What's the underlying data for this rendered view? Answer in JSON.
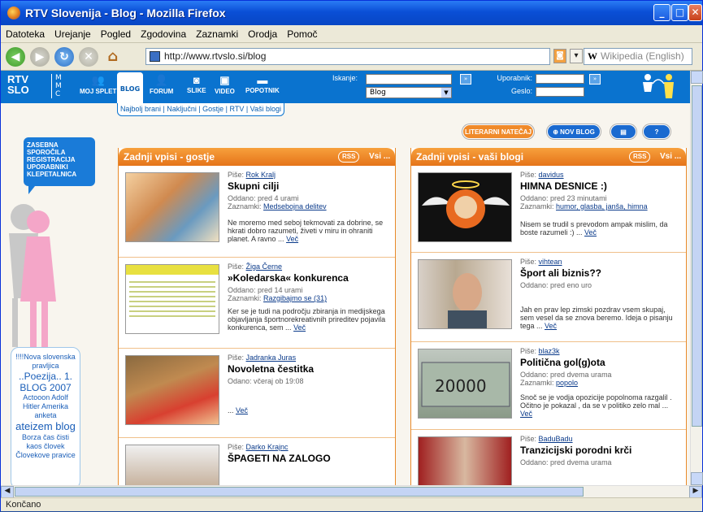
{
  "window": {
    "title": "RTV Slovenija - Blog - Mozilla Firefox"
  },
  "menu": [
    "Datoteka",
    "Urejanje",
    "Pogled",
    "Zgodovina",
    "Zaznamki",
    "Orodja",
    "Pomoč"
  ],
  "nav": {
    "url": "http://www.rtvslo.si/blog",
    "search_engine": "W",
    "search_placeholder": "Wikipedia (English)"
  },
  "status": "Končano",
  "site": {
    "logo_line1": "RTV",
    "logo_line2": "SLO",
    "mmc": "M M C",
    "topnav": [
      {
        "label": "MOJ SPLET",
        "icon": "people-icon"
      },
      {
        "label": "BLOG",
        "icon": ""
      },
      {
        "label": "FORUM",
        "icon": "forum-icon"
      },
      {
        "label": "SLIKE",
        "icon": "camera-icon"
      },
      {
        "label": "VIDEO",
        "icon": "video-icon"
      },
      {
        "label": "POPOTNIK",
        "icon": "suitcase-icon"
      }
    ],
    "subnav": "Najbolj brani | Naključni | Gostje | RTV | Vaši blogi",
    "search_label": "Iskanje:",
    "search_select": "Blog",
    "user_label": "Uporabnik:",
    "password_label": "Geslo:",
    "buttons": {
      "literary": "LITERARNI NATEČAJ",
      "new_blog": "NOV BLOG",
      "help": "?"
    },
    "sidebar_bubble": [
      "ZASEBNA SPOROČILA",
      "REGISTRACIJA",
      "UPORABNIKI",
      "KLEPETALNICA"
    ],
    "tag_cloud": [
      {
        "text": "!!!!Nova slovenska",
        "size": 9
      },
      {
        "text": "pravljica",
        "size": 9
      },
      {
        "text": "..Poezija.. 1.",
        "size": 12
      },
      {
        "text": "BLOG 2007",
        "size": 12
      },
      {
        "text": "Actooon Adolf",
        "size": 9
      },
      {
        "text": "Hitler Amerika",
        "size": 9
      },
      {
        "text": "anketa",
        "size": 9
      },
      {
        "text": "ateizem blog",
        "size": 13
      },
      {
        "text": "Borza čas čisti",
        "size": 9
      },
      {
        "text": "kaos človek",
        "size": 9
      },
      {
        "text": "Človekove pravice",
        "size": 9
      }
    ]
  },
  "panels": [
    {
      "title": "Zadnji vpisi - gostje",
      "rss": "RSS",
      "all": "Vsi ...",
      "entries": [
        {
          "pise": "Piše:",
          "author": "Rok Kralj",
          "title": "Skupni cilji",
          "posted": "Oddano: pred 4 urami",
          "tags_label": "Zaznamki:",
          "tags": "Medsebojna delitev",
          "body": "Ne moremo med seboj tekmovati za dobrine, se hkrati dobro razumeti, živeti v miru in ohraniti planet. A ravno ...",
          "more": "Več",
          "thumb": "hands"
        },
        {
          "pise": "Piše:",
          "author": "Žiga Černe",
          "title": "»Koledarska« konkurenca",
          "posted": "Oddano: pred 14 urami",
          "tags_label": "Zaznamki:",
          "tags": "Razgibajmo se (31)",
          "body": "Ker se je tudi na področju zbiranja in medijskega objavljanja športnorekreativnih prireditev pojavila konkurenca, sem ...",
          "more": "Več",
          "thumb": "webpage"
        },
        {
          "pise": "Piše:",
          "author": "Jadranka Juras",
          "title": "Novoletna čestitka",
          "posted": "Odano: včeraj ob 19:08",
          "tags_label": "",
          "tags": "",
          "body": "...",
          "more": "Več",
          "thumb": "dog"
        },
        {
          "pise": "Piše:",
          "author": "Darko Krajnc",
          "title": "ŠPAGETI NA ZALOGO",
          "posted": "",
          "tags_label": "",
          "tags": "",
          "body": "",
          "more": "",
          "thumb": "man"
        }
      ]
    },
    {
      "title": "Zadnji vpisi - vaši blogi",
      "rss": "RSS",
      "all": "Vsi ...",
      "entries": [
        {
          "pise": "Piše:",
          "author": "davidus",
          "title": "HIMNA DESNICE :)",
          "posted": "Oddano: pred 23 minutami",
          "tags_label": "Zaznamki:",
          "tags": "humor, glasba, janša, himna",
          "body": "Nisem se trudil s prevodom ampak mislim, da boste razumeli :) ...",
          "more": "Več",
          "thumb": "cartoon"
        },
        {
          "pise": "Piše:",
          "author": "vihtean",
          "title": "Šport ali biznis??",
          "posted": "Oddano: pred eno uro",
          "tags_label": "",
          "tags": "",
          "body": "Jah en prav lep zimski pozdrav vsem skupaj, sem vesel da se znova beremo. Ideja o pisanju tega ...",
          "more": "Več",
          "thumb": "face"
        },
        {
          "pise": "Piše:",
          "author": "blaz3k",
          "title": "Politična gol(g)ota",
          "posted": "Oddano: pred dvema urama",
          "tags_label": "Zaznamki:",
          "tags": "popolo",
          "body": "Snoč se je vodja opozicije popolnoma razgalil . Očitno je pokazal , da se v politiko zelo mal ...",
          "more": "Več",
          "thumb": "banknote"
        },
        {
          "pise": "Piše:",
          "author": "BaduBadu",
          "title": "Tranzicijski porodni krči",
          "posted": "Oddano: pred dvema urama",
          "tags_label": "",
          "tags": "",
          "body": "",
          "more": "",
          "thumb": "politician"
        }
      ]
    }
  ]
}
